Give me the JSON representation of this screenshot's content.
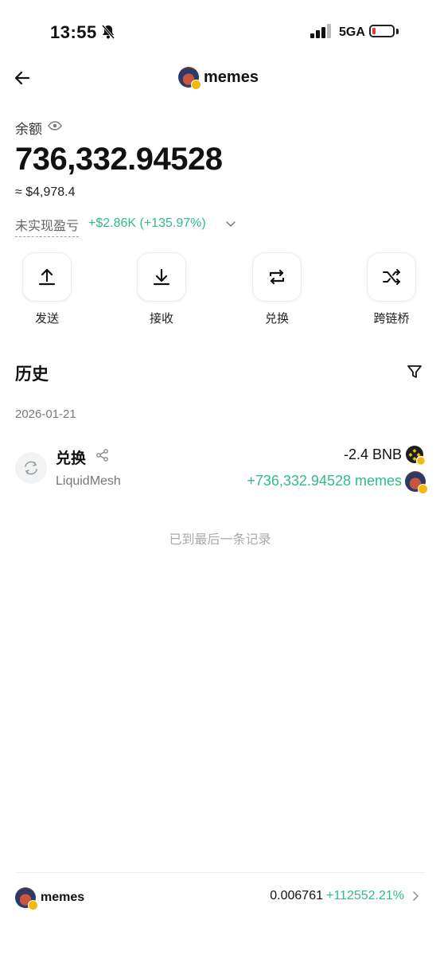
{
  "status_bar": {
    "time": "13:55",
    "network": "5GA"
  },
  "header": {
    "title": "memes",
    "avatar_icon": "memes-token-icon"
  },
  "balance": {
    "label": "余额",
    "amount": "736,332.94528",
    "usd": "≈ $4,978.4",
    "pnl_label": "未实现盈亏",
    "pnl_value": "+$2.86K (+135.97%)"
  },
  "actions": [
    {
      "label": "发送",
      "icon": "upload-icon"
    },
    {
      "label": "接收",
      "icon": "download-icon"
    },
    {
      "label": "兑换",
      "icon": "swap-arrows-icon"
    },
    {
      "label": "跨链桥",
      "icon": "shuffle-icon"
    }
  ],
  "history": {
    "title": "历史",
    "date": "2026-01-21",
    "transactions": [
      {
        "type": "兑换",
        "source": "LiquidMesh",
        "out_amount": "-2.4 BNB",
        "in_amount": "+736,332.94528 memes"
      }
    ],
    "end_note": "已到最后一条记录"
  },
  "footer": {
    "token": "memes",
    "price": "0.006761",
    "change": "+112552.21%"
  },
  "colors": {
    "positive": "#2ebd85",
    "badge": "#f0b90b"
  }
}
